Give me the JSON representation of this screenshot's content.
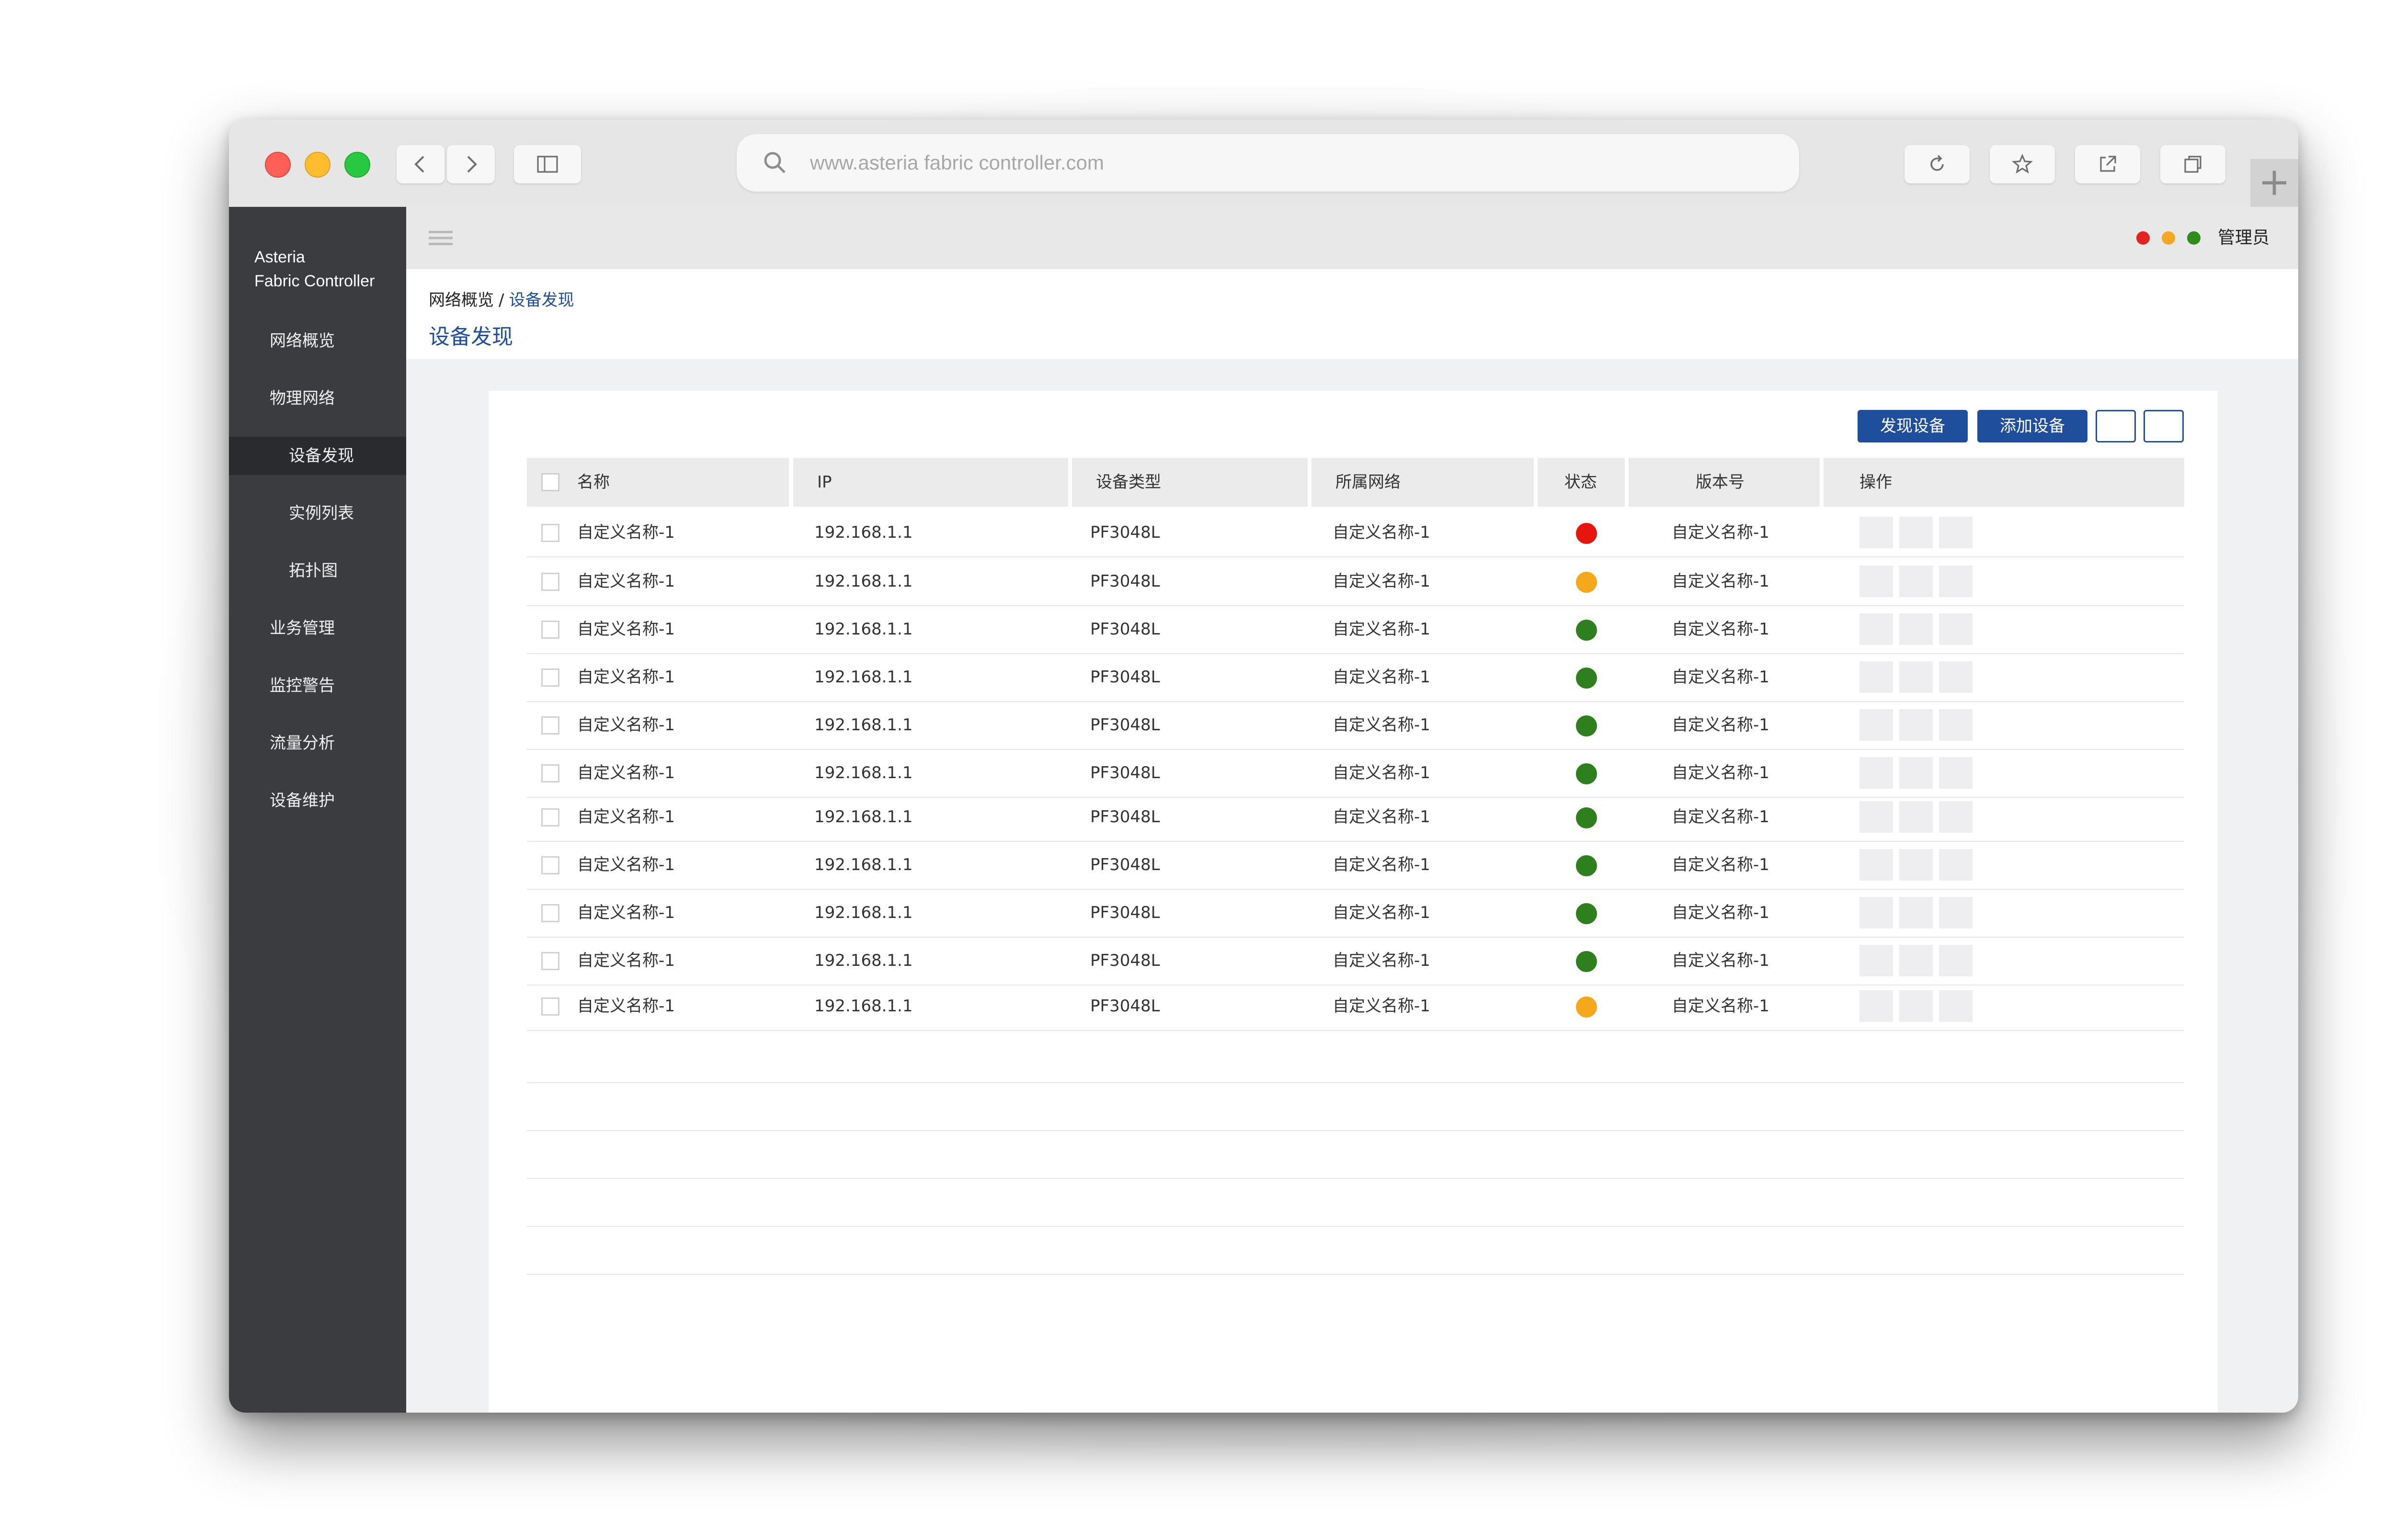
{
  "browser": {
    "url": "www.asteria fabric controller.com",
    "icons": [
      "back-icon",
      "forward-icon",
      "sidebar-toggle-icon",
      "reload-icon",
      "bookmark-star-icon",
      "share-icon",
      "tabs-icon",
      "new-tab-icon"
    ],
    "new_tab": "+"
  },
  "app": {
    "brand_line1": "Asteria",
    "brand_line2": "Fabric Controller",
    "nav": [
      {
        "label": "网络概览",
        "level": 1,
        "active": false
      },
      {
        "label": "物理网络",
        "level": 1,
        "active": false
      },
      {
        "label": "设备发现",
        "level": 2,
        "active": true
      },
      {
        "label": "实例列表",
        "level": 2,
        "active": false
      },
      {
        "label": "拓扑图",
        "level": 2,
        "active": false
      },
      {
        "label": "业务管理",
        "level": 1,
        "active": false
      },
      {
        "label": "监控警告",
        "level": 1,
        "active": false
      },
      {
        "label": "流量分析",
        "level": 1,
        "active": false
      },
      {
        "label": "设备维护",
        "level": 1,
        "active": false
      }
    ]
  },
  "topbar": {
    "status_colors": [
      "#e32222",
      "#f5a623",
      "#2e8b1e"
    ],
    "user_label": "管理员"
  },
  "breadcrumb": {
    "parent": "网络概览",
    "separator": "/",
    "current": "设备发现"
  },
  "page_title": "设备发现",
  "actions": {
    "discover": "发现设备",
    "add": "添加设备"
  },
  "table": {
    "headers": [
      "名称",
      "IP",
      "设备类型",
      "所属网络",
      "状态",
      "版本号",
      "操作"
    ],
    "status_colors": {
      "red": "#e8150f",
      "yellow": "#f5a81b",
      "green": "#2e7f1d"
    },
    "rows": [
      {
        "name": "自定义名称-1",
        "ip": "192.168.1.1",
        "type": "PF3048L",
        "network": "自定义名称-1",
        "status": "red",
        "version": "自定义名称-1"
      },
      {
        "name": "自定义名称-1",
        "ip": "192.168.1.1",
        "type": "PF3048L",
        "network": "自定义名称-1",
        "status": "yellow",
        "version": "自定义名称-1"
      },
      {
        "name": "自定义名称-1",
        "ip": "192.168.1.1",
        "type": "PF3048L",
        "network": "自定义名称-1",
        "status": "green",
        "version": "自定义名称-1"
      },
      {
        "name": "自定义名称-1",
        "ip": "192.168.1.1",
        "type": "PF3048L",
        "network": "自定义名称-1",
        "status": "green",
        "version": "自定义名称-1"
      },
      {
        "name": "自定义名称-1",
        "ip": "192.168.1.1",
        "type": "PF3048L",
        "network": "自定义名称-1",
        "status": "green",
        "version": "自定义名称-1"
      },
      {
        "name": "自定义名称-1",
        "ip": "192.168.1.1",
        "type": "PF3048L",
        "network": "自定义名称-1",
        "status": "green",
        "version": "自定义名称-1"
      },
      {
        "name": "自定义名称-1",
        "ip": "192.168.1.1",
        "type": "PF3048L",
        "network": "自定义名称-1",
        "status": "green",
        "version": "自定义名称-1"
      },
      {
        "name": "自定义名称-1",
        "ip": "192.168.1.1",
        "type": "PF3048L",
        "network": "自定义名称-1",
        "status": "green",
        "version": "自定义名称-1"
      },
      {
        "name": "自定义名称-1",
        "ip": "192.168.1.1",
        "type": "PF3048L",
        "network": "自定义名称-1",
        "status": "green",
        "version": "自定义名称-1"
      },
      {
        "name": "自定义名称-1",
        "ip": "192.168.1.1",
        "type": "PF3048L",
        "network": "自定义名称-1",
        "status": "green",
        "version": "自定义名称-1"
      },
      {
        "name": "自定义名称-1",
        "ip": "192.168.1.1",
        "type": "PF3048L",
        "network": "自定义名称-1",
        "status": "yellow",
        "version": "自定义名称-1"
      }
    ]
  }
}
